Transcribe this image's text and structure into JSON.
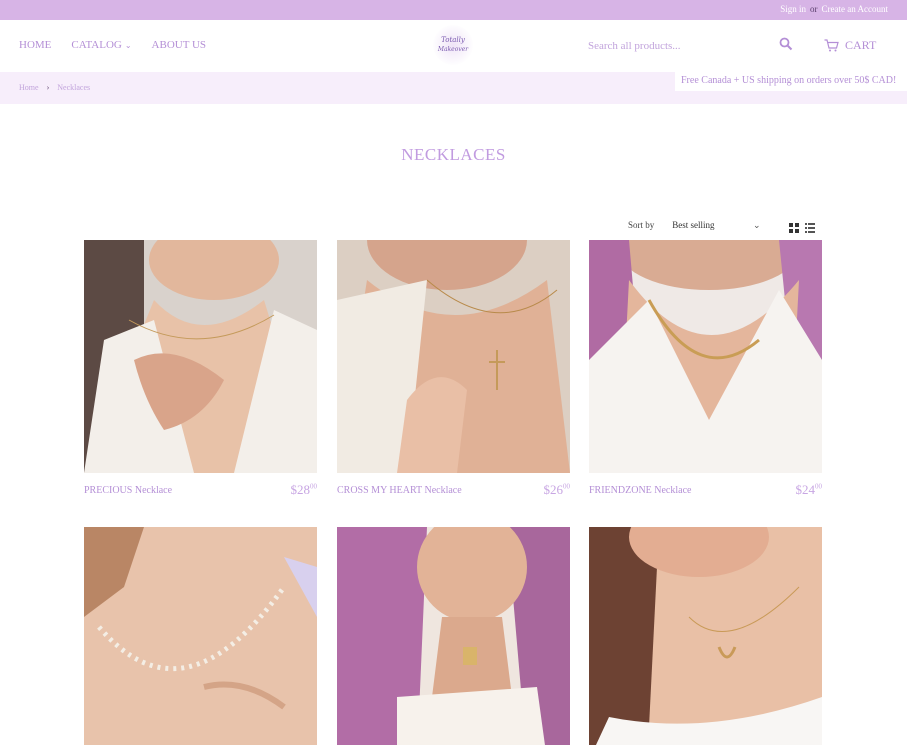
{
  "topbar": {
    "sign_in": "Sign in",
    "or": "or",
    "create_account": "Create an Account"
  },
  "nav": {
    "home": "HOME",
    "catalog": "CATALOG",
    "about": "ABOUT US"
  },
  "logo": {
    "text": "Totally Makeover"
  },
  "search": {
    "placeholder": "Search all products..."
  },
  "cart": {
    "label": "CART"
  },
  "breadcrumb": {
    "home": "Home",
    "sep": "›",
    "current": "Necklaces"
  },
  "shipping_notice": "Free Canada + US shipping on orders over 50$ CAD!",
  "page_title": "NECKLACES",
  "sort": {
    "label": "Sort by",
    "value": "Best selling"
  },
  "products": [
    {
      "name": "PRECIOUS Necklace",
      "price_main": "$28",
      "price_cents": "00"
    },
    {
      "name": "CROSS MY HEART Necklace",
      "price_main": "$26",
      "price_cents": "00"
    },
    {
      "name": "FRIENDZONE Necklace",
      "price_main": "$24",
      "price_cents": "00"
    },
    {
      "name": "",
      "price_main": "",
      "price_cents": ""
    },
    {
      "name": "",
      "price_main": "",
      "price_cents": ""
    },
    {
      "name": "",
      "price_main": "",
      "price_cents": ""
    }
  ],
  "colors": {
    "topbar": "#d7b4e6",
    "accent": "#b48fd6",
    "breadcrumb_bg": "#f7eefb"
  },
  "icons": [
    "search-icon",
    "cart-icon",
    "grid-view-icon",
    "list-view-icon",
    "chevron-down-icon"
  ]
}
